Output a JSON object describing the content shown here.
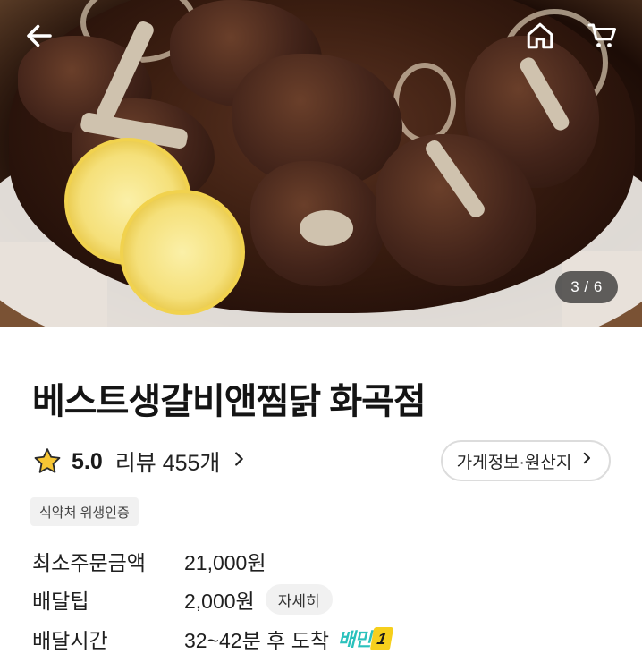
{
  "hero": {
    "pager": "3 / 6"
  },
  "store": {
    "name": "베스트생갈비앤찜닭 화곡점",
    "rating": "5.0",
    "review_text": "리뷰 455개",
    "info_button": "가게정보·원산지",
    "badge": "식약처 위생인증"
  },
  "details": {
    "min_order_label": "최소주문금액",
    "min_order_value": "21,000원",
    "tip_label": "배달팁",
    "tip_value": "2,000원",
    "tip_detail_button": "자세히",
    "time_label": "배달시간",
    "time_value": "32~42분 후 도착",
    "baemin_logo_text": "배민",
    "baemin_logo_num": "1"
  },
  "icons": {
    "back": "arrow-left-icon",
    "home": "home-icon",
    "cart": "cart-icon",
    "star": "star-icon",
    "chevron": "chevron-right-icon"
  },
  "colors": {
    "star_fill": "#f7c634",
    "baemin_mint": "#2ac1bc",
    "baemin_yellow": "#f6cf1c"
  }
}
